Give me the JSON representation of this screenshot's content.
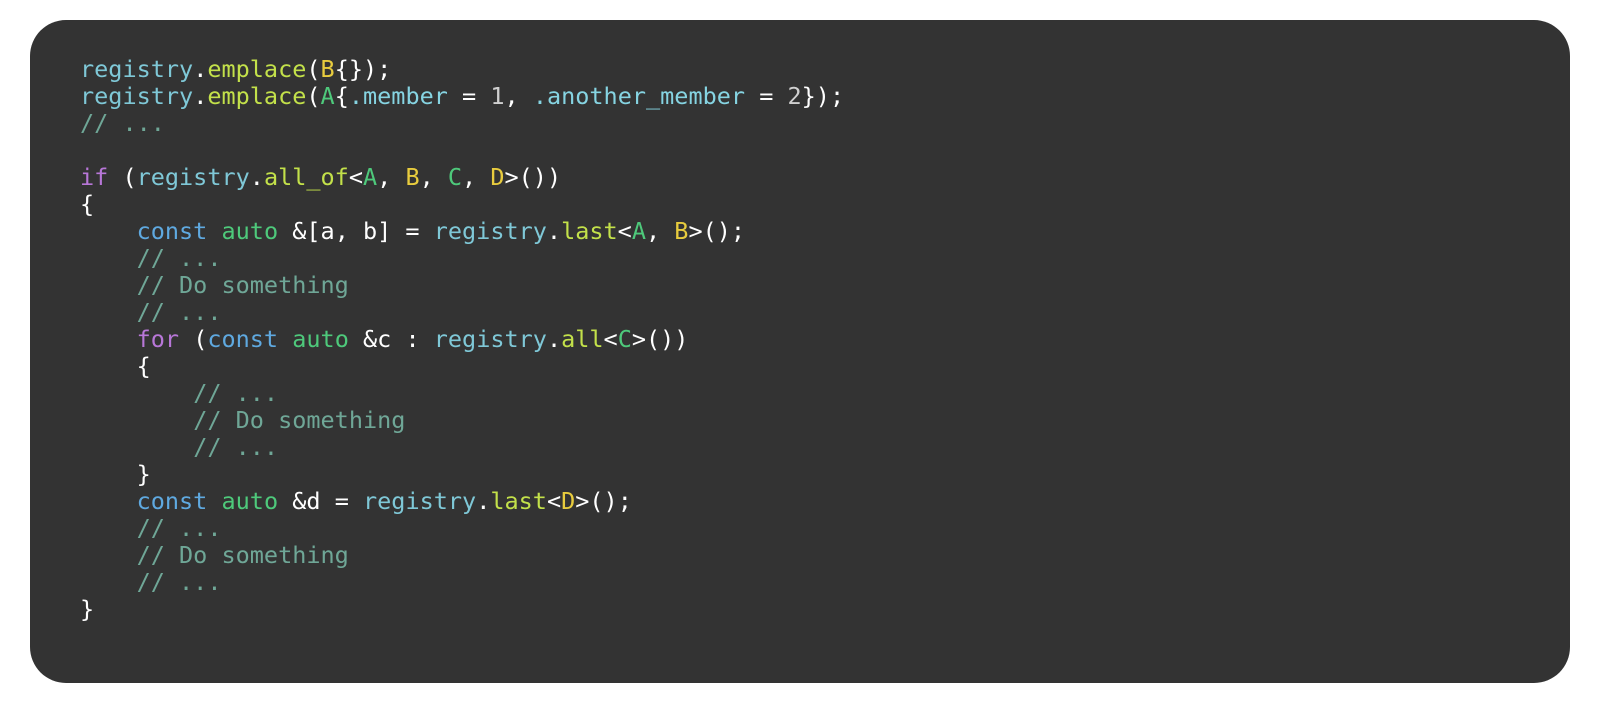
{
  "code": {
    "l1": {
      "registry": "registry",
      "dot": ".",
      "emplace": "emplace",
      "op": "(",
      "B": "B",
      "br": "{});"
    },
    "l2": {
      "registry": "registry",
      "dot": ".",
      "emplace": "emplace",
      "op": "(",
      "A": "A",
      "br_open": "{",
      "m1k": ".member",
      "eq1": " = ",
      "m1v": "1",
      "comma": ", ",
      "m2k": ".another_member",
      "eq2": " = ",
      "m2v": "2",
      "br_close": "});"
    },
    "l3": {
      "comment": "// ..."
    },
    "l4": {
      "blank": ""
    },
    "l5": {
      "if": "if",
      "sp": " (",
      "registry": "registry",
      "dot": ".",
      "all_of": "all_of",
      "lt": "<",
      "A": "A",
      "c1": ", ",
      "B": "B",
      "c2": ", ",
      "C": "C",
      "c3": ", ",
      "D": "D",
      "gt": ">())"
    },
    "l6": {
      "brace": "{"
    },
    "l7": {
      "indent": "    ",
      "const": "const",
      "sp1": " ",
      "auto": "auto",
      "sp2": " ",
      "amp_br": "&[a, b] = ",
      "registry": "registry",
      "dot": ".",
      "last": "last",
      "lt": "<",
      "A": "A",
      "c": ", ",
      "B": "B",
      "gt": ">();"
    },
    "l8": {
      "indent": "    ",
      "comment": "// ..."
    },
    "l9": {
      "indent": "    ",
      "comment": "// Do something"
    },
    "l10": {
      "indent": "    ",
      "comment": "// ..."
    },
    "l11": {
      "indent": "    ",
      "for": "for",
      "sp": " (",
      "const": "const",
      "sp1": " ",
      "auto": "auto",
      "sp2": " ",
      "amp": "&c : ",
      "registry": "registry",
      "dot": ".",
      "all": "all",
      "lt": "<",
      "C": "C",
      "gt": ">())"
    },
    "l12": {
      "indent": "    ",
      "brace": "{"
    },
    "l13": {
      "indent": "        ",
      "comment": "// ..."
    },
    "l14": {
      "indent": "        ",
      "comment": "// Do something"
    },
    "l15": {
      "indent": "        ",
      "comment": "// ..."
    },
    "l16": {
      "indent": "    ",
      "brace": "}"
    },
    "l17": {
      "indent": "    ",
      "const": "const",
      "sp1": " ",
      "auto": "auto",
      "sp2": " ",
      "amp": "&d = ",
      "registry": "registry",
      "dot": ".",
      "last": "last",
      "lt": "<",
      "D": "D",
      "gt": ">();"
    },
    "l18": {
      "indent": "    ",
      "comment": "// ..."
    },
    "l19": {
      "indent": "    ",
      "comment": "// Do something"
    },
    "l20": {
      "indent": "    ",
      "comment": "// ..."
    },
    "l21": {
      "brace": "}"
    }
  }
}
